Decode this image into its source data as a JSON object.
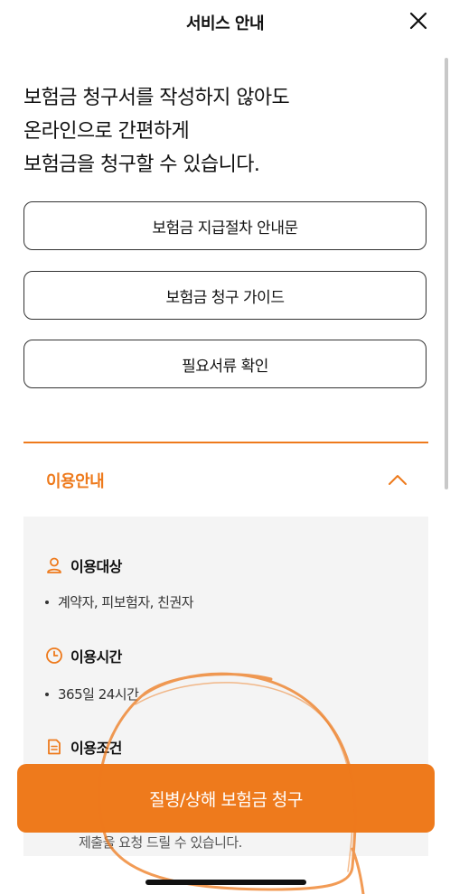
{
  "header": {
    "title": "서비스 안내"
  },
  "intro": {
    "lines": [
      "보험금 청구서를 작성하지 않아도",
      "온라인으로 간편하게",
      "보험금을 청구할 수 있습니다."
    ]
  },
  "buttons": {
    "procedure": "보험금 지급절차 안내문",
    "guide": "보험금 청구 가이드",
    "documents": "필요서류 확인"
  },
  "accordion": {
    "title": "이용안내",
    "sections": [
      {
        "title": "이용대상",
        "icon": "person-icon",
        "items": [
          "계약자, 피보험자, 친권자"
        ]
      },
      {
        "title": "이용시간",
        "icon": "clock-icon",
        "items": [
          "365일 24시간"
        ]
      },
      {
        "title": "이용조건",
        "icon": "document-icon"
      }
    ],
    "note": "제출을 요청 드릴 수 있습니다."
  },
  "cta": {
    "label": "질병/상해 보험금 청구"
  },
  "colors": {
    "accent": "#ee7a1c",
    "panel_bg": "#f4f4f4",
    "text": "#111111"
  }
}
